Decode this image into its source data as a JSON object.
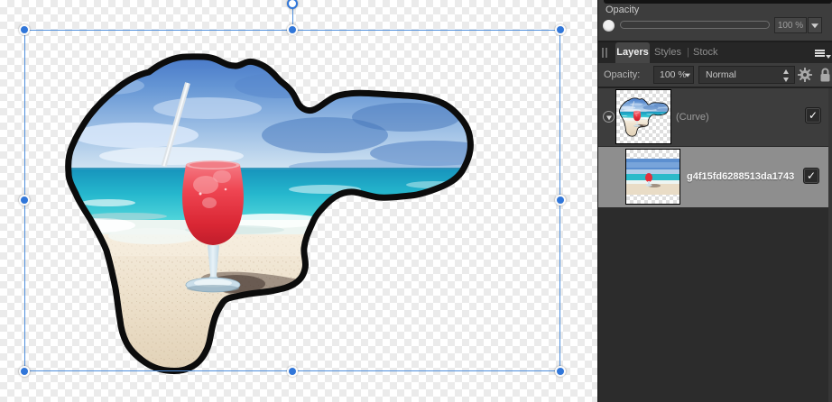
{
  "panel": {
    "opacity_top": {
      "label": "Opacity",
      "value": "100 %"
    },
    "tabs": {
      "layers": "Layers",
      "styles": "Styles",
      "stock": "Stock",
      "divider": "|"
    },
    "controls": {
      "opacity_label": "Opacity:",
      "opacity_value": "100 %",
      "blend_mode": "Normal"
    },
    "layers": [
      {
        "label": "(Curve)",
        "checked": true
      },
      {
        "label": "g4f15fd6288513da1743",
        "checked": true
      }
    ]
  },
  "icons": {
    "checkmark": "✓"
  },
  "colors": {
    "accent": "#3076d9",
    "selected_row": "#8e8e8e",
    "panel_bg": "#3d3d3d",
    "outline": "#0c0c0c"
  }
}
